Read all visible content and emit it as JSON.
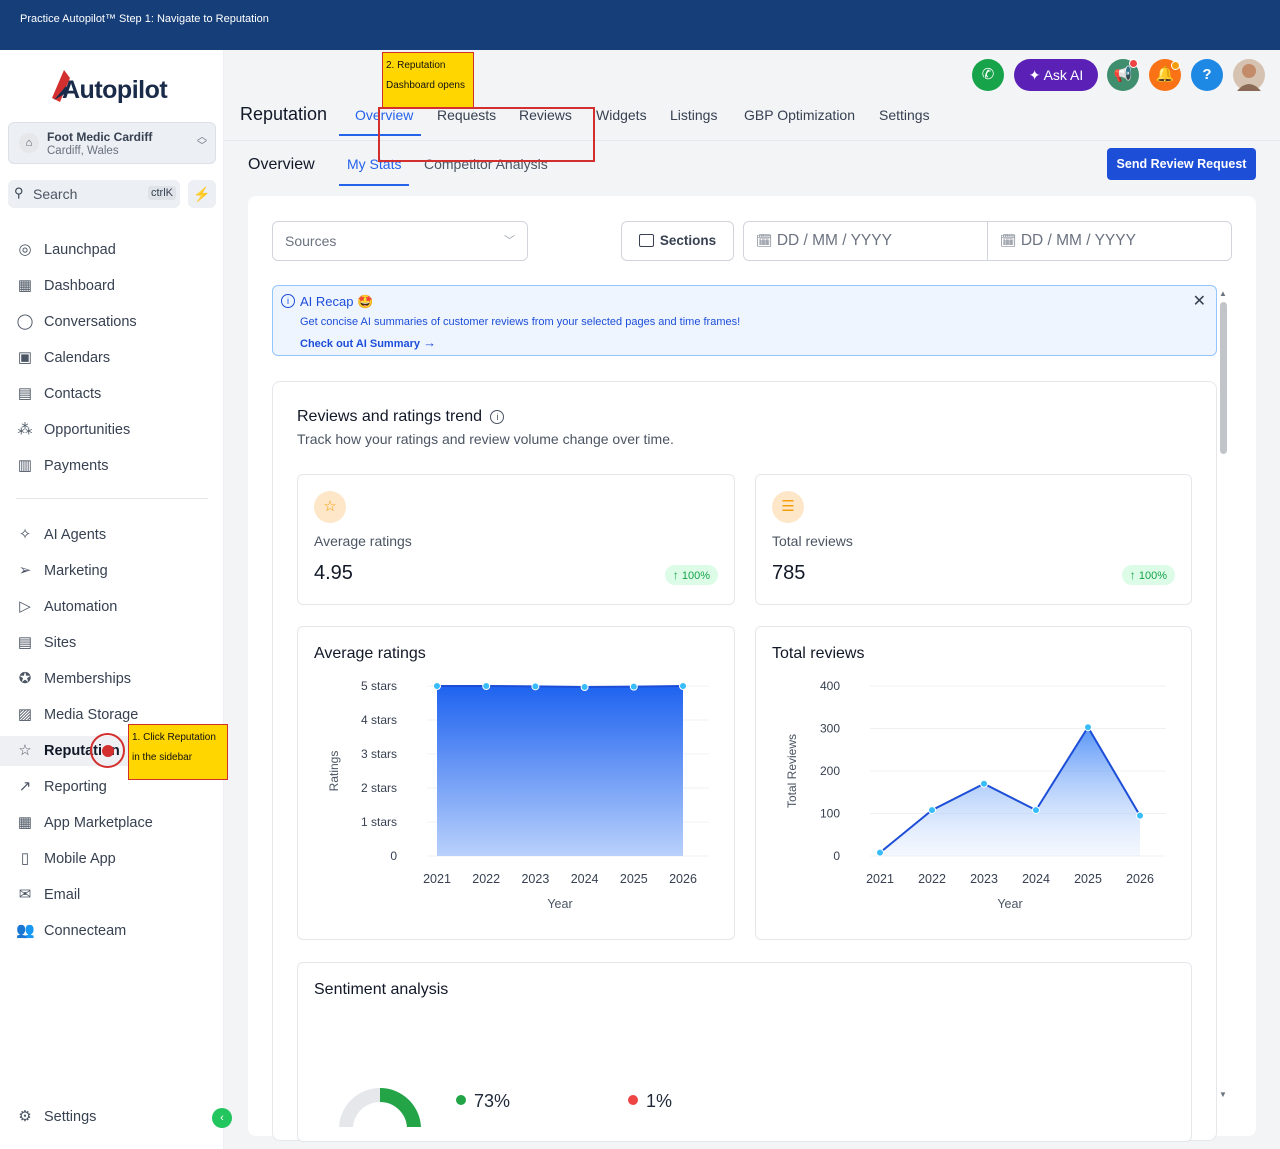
{
  "topbar": {
    "title": "Practice Autopilot™ Step 1: Navigate to Reputation"
  },
  "sidebar": {
    "logo_text": "Autopilot",
    "location": {
      "name": "Foot Medic Cardiff",
      "sub": "Cardiff, Wales"
    },
    "search": {
      "placeholder": "Search",
      "shortcut": "ctrlK"
    },
    "items_top": [
      {
        "label": "Launchpad",
        "icon": "rocket-icon"
      },
      {
        "label": "Dashboard",
        "icon": "grid-icon"
      },
      {
        "label": "Conversations",
        "icon": "chat-icon"
      },
      {
        "label": "Calendars",
        "icon": "calendar-icon"
      },
      {
        "label": "Contacts",
        "icon": "contacts-icon"
      },
      {
        "label": "Opportunities",
        "icon": "network-icon"
      },
      {
        "label": "Payments",
        "icon": "receipt-icon"
      }
    ],
    "items_bottom": [
      {
        "label": "AI Agents",
        "icon": "sparkle-icon"
      },
      {
        "label": "Marketing",
        "icon": "send-icon"
      },
      {
        "label": "Automation",
        "icon": "play-icon"
      },
      {
        "label": "Sites",
        "icon": "sites-icon"
      },
      {
        "label": "Memberships",
        "icon": "award-icon"
      },
      {
        "label": "Media Storage",
        "icon": "image-icon"
      },
      {
        "label": "Reputation",
        "icon": "star-icon"
      },
      {
        "label": "Reporting",
        "icon": "trend-icon"
      },
      {
        "label": "App Marketplace",
        "icon": "apps-icon"
      },
      {
        "label": "Mobile App",
        "icon": "phone-icon"
      },
      {
        "label": "Email",
        "icon": "mail-icon"
      },
      {
        "label": "Connecteam",
        "icon": "team-icon"
      }
    ],
    "settings": "Settings"
  },
  "header": {
    "ask_ai": "Ask AI",
    "help": "?"
  },
  "page": {
    "title": "Reputation",
    "tabs": [
      "Overview",
      "Requests",
      "Reviews",
      "Widgets",
      "Listings",
      "GBP Optimization",
      "Settings"
    ],
    "sub_title": "Overview",
    "subtabs": [
      "My Stats",
      "Competitor Analysis"
    ],
    "send_button": "Send Review Request"
  },
  "filters": {
    "sources_placeholder": "Sources",
    "sections_label": "Sections",
    "date_from": "DD / MM / YYYY",
    "date_to": "DD / MM / YYYY"
  },
  "recap": {
    "title": "AI Recap 🤩",
    "desc": "Get concise AI summaries of customer reviews from your selected pages and time frames!",
    "link": "Check out AI Summary"
  },
  "trend": {
    "title": "Reviews and ratings trend",
    "subtitle": "Track how your ratings and review volume change over time."
  },
  "stats": {
    "avg": {
      "label": "Average ratings",
      "value": "4.95",
      "change": "100%"
    },
    "total": {
      "label": "Total reviews",
      "value": "785",
      "change": "100%"
    }
  },
  "sentiment": {
    "title": "Sentiment analysis",
    "positive": "73%",
    "negative": "1%"
  },
  "annotations": {
    "step1": "1. Click Reputation in the sidebar",
    "step2": "2. Reputation Dashboard opens"
  },
  "colors": {
    "accent": "#2563eb",
    "topbar": "#163f7a",
    "annotation": "#ffd600",
    "annotation_border": "#d32f2f"
  },
  "chart_data": [
    {
      "type": "area",
      "title": "Average ratings",
      "xlabel": "Year",
      "ylabel": "Ratings",
      "x": [
        "2021",
        "2022",
        "2023",
        "2024",
        "2025",
        "2026"
      ],
      "y_tick_labels": [
        "0",
        "1 stars",
        "2 stars",
        "3 stars",
        "4 stars",
        "5 stars"
      ],
      "values": [
        5,
        5,
        4.99,
        4.97,
        4.98,
        5
      ],
      "ylim": [
        0,
        5
      ]
    },
    {
      "type": "area",
      "title": "Total reviews",
      "xlabel": "Year",
      "ylabel": "Total Reviews",
      "x": [
        "2021",
        "2022",
        "2023",
        "2024",
        "2025",
        "2026"
      ],
      "y_tick_labels": [
        "0",
        "100",
        "200",
        "300",
        "400"
      ],
      "values": [
        8,
        108,
        170,
        108,
        303,
        95
      ],
      "ylim": [
        0,
        400
      ]
    }
  ]
}
